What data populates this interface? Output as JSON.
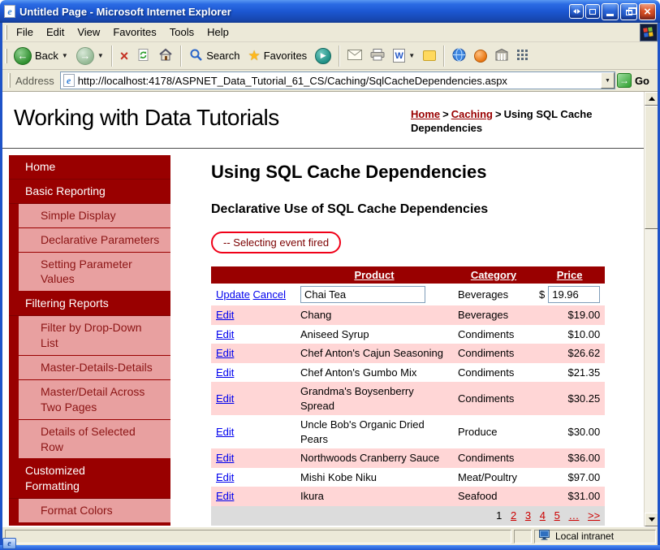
{
  "window": {
    "title": "Untitled Page - Microsoft Internet Explorer",
    "menu": [
      "File",
      "Edit",
      "View",
      "Favorites",
      "Tools",
      "Help"
    ],
    "toolbar": {
      "back": "Back",
      "search": "Search",
      "favorites": "Favorites"
    },
    "address": {
      "label": "Address",
      "url": "http://localhost:4178/ASPNET_Data_Tutorial_61_CS/Caching/SqlCacheDependencies.aspx",
      "go": "Go"
    },
    "status": {
      "zone": "Local intranet"
    }
  },
  "icons": {
    "back_arrow": "←",
    "forward_arrow": "→",
    "stop": "×",
    "star": "★",
    "play": "▶",
    "caret": "▼",
    "go_arrow": "→"
  },
  "page": {
    "site_title": "Working with Data Tutorials",
    "breadcrumb": {
      "home": "Home",
      "caching": "Caching",
      "sep": ">",
      "current": "Using SQL Cache Dependencies"
    },
    "sidebar": {
      "items": [
        {
          "label": "Home",
          "type": "header"
        },
        {
          "label": "Basic Reporting",
          "type": "header"
        },
        {
          "label": "Simple Display",
          "type": "item"
        },
        {
          "label": "Declarative Parameters",
          "type": "item"
        },
        {
          "label": "Setting Parameter Values",
          "type": "item"
        },
        {
          "label": "Filtering Reports",
          "type": "header"
        },
        {
          "label": "Filter by Drop-Down List",
          "type": "item"
        },
        {
          "label": "Master-Details-Details",
          "type": "item"
        },
        {
          "label": "Master/Detail Across Two Pages",
          "type": "item"
        },
        {
          "label": "Details of Selected Row",
          "type": "item"
        },
        {
          "label": "Customized Formatting",
          "type": "header"
        },
        {
          "label": "Format Colors",
          "type": "item"
        }
      ]
    },
    "main": {
      "title": "Using SQL Cache Dependencies",
      "subtitle": "Declarative Use of SQL Cache Dependencies",
      "event_message": "-- Selecting event fired",
      "grid": {
        "headers": {
          "product": "Product",
          "category": "Category",
          "price": "Price"
        },
        "edit_label": "Edit",
        "edit_row": {
          "update": "Update",
          "cancel": "Cancel",
          "product": "Chai Tea",
          "category": "Beverages",
          "currency": "$",
          "price": "19.96"
        },
        "rows": [
          {
            "product": "Chang",
            "category": "Beverages",
            "price": "$19.00"
          },
          {
            "product": "Aniseed Syrup",
            "category": "Condiments",
            "price": "$10.00"
          },
          {
            "product": "Chef Anton's Cajun Seasoning",
            "category": "Condiments",
            "price": "$26.62"
          },
          {
            "product": "Chef Anton's Gumbo Mix",
            "category": "Condiments",
            "price": "$21.35"
          },
          {
            "product": "Grandma's Boysenberry Spread",
            "category": "Condiments",
            "price": "$30.25"
          },
          {
            "product": "Uncle Bob's Organic Dried Pears",
            "category": "Produce",
            "price": "$30.00"
          },
          {
            "product": "Northwoods Cranberry Sauce",
            "category": "Condiments",
            "price": "$36.00"
          },
          {
            "product": "Mishi Kobe Niku",
            "category": "Meat/Poultry",
            "price": "$97.00"
          },
          {
            "product": "Ikura",
            "category": "Seafood",
            "price": "$31.00"
          }
        ],
        "pager": {
          "current": "1",
          "links": [
            "2",
            "3",
            "4",
            "5",
            "…",
            ">>"
          ]
        }
      }
    }
  },
  "colors": {
    "maroon": "#990000",
    "sidebar_pink": "#E8A0A0",
    "row_pink": "#FFD6D6",
    "annotation_red": "#F00018",
    "link_blue": "#0000EE",
    "pager_red": "#CC0000",
    "titlebar_blue": "#1C57D2"
  }
}
